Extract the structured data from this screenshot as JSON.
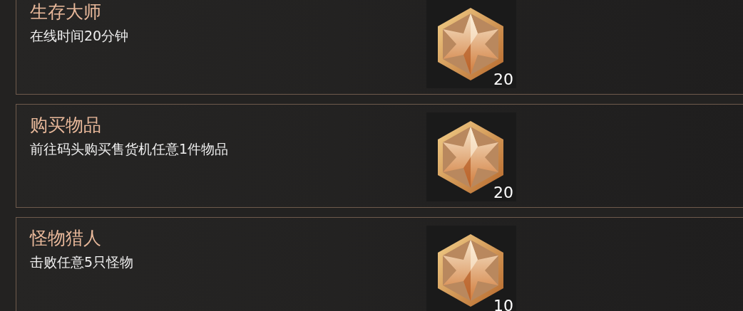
{
  "tasks": [
    {
      "title": "生存大师",
      "description": "在线时间20分钟",
      "reward": {
        "count": "20"
      }
    },
    {
      "title": "购买物品",
      "description": "前往码头购买售货机任意1件物品",
      "reward": {
        "count": "20"
      }
    },
    {
      "title": "怪物猎人",
      "description": "击败任意5只怪物",
      "reward": {
        "count": "10"
      }
    }
  ]
}
